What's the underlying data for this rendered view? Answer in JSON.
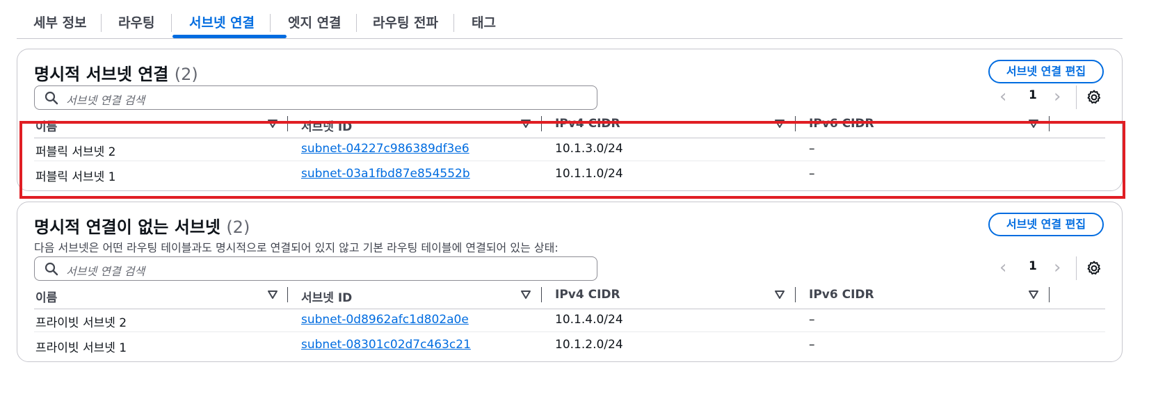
{
  "tabs": [
    {
      "label": "세부 정보"
    },
    {
      "label": "라우팅"
    },
    {
      "label": "서브넷 연결"
    },
    {
      "label": "엣지 연결"
    },
    {
      "label": "라우팅 전파"
    },
    {
      "label": "태그"
    }
  ],
  "active_tab": "서브넷 연결",
  "explicit": {
    "title": "명시적 서브넷 연결",
    "count": "(2)",
    "edit_label": "서브넷 연결 편집",
    "search_placeholder": "서브넷 연결 검색",
    "page": "1",
    "columns": [
      "이름",
      "서브넷 ID",
      "IPv4 CIDR",
      "IPv6 CIDR"
    ],
    "rows": [
      {
        "name": "퍼블릭 서브넷 2",
        "subnet_id": "subnet-04227c986389df3e6",
        "ipv4": "10.1.3.0/24",
        "ipv6": "–"
      },
      {
        "name": "퍼블릭 서브넷 1",
        "subnet_id": "subnet-03a1fbd87e854552b",
        "ipv4": "10.1.1.0/24",
        "ipv6": "–"
      }
    ]
  },
  "implicit": {
    "title": "명시적 연결이 없는 서브넷",
    "count": "(2)",
    "description": "다음 서브넷은 어떤 라우팅 테이블과도 명시적으로 연결되어 있지 않고 기본 라우팅 테이블에 연결되어 있는 상태:",
    "edit_label": "서브넷 연결 편집",
    "search_placeholder": "서브넷 연결 검색",
    "page": "1",
    "columns": [
      "이름",
      "서브넷 ID",
      "IPv4 CIDR",
      "IPv6 CIDR"
    ],
    "rows": [
      {
        "name": "프라이빗 서브넷 2",
        "subnet_id": "subnet-0d8962afc1d802a0e",
        "ipv4": "10.1.4.0/24",
        "ipv6": "–"
      },
      {
        "name": "프라이빗 서브넷 1",
        "subnet_id": "subnet-08301c02d7c463c21",
        "ipv4": "10.1.2.0/24",
        "ipv6": "–"
      }
    ]
  },
  "icons": {
    "search": "search-icon",
    "settings": "gear-icon",
    "sort": "sort-triangle-icon",
    "prev": "chevron-left-icon",
    "next": "chevron-right-icon"
  },
  "colors": {
    "accent": "#006ce0",
    "highlight": "#e01e24",
    "border": "#c6c6cd"
  }
}
